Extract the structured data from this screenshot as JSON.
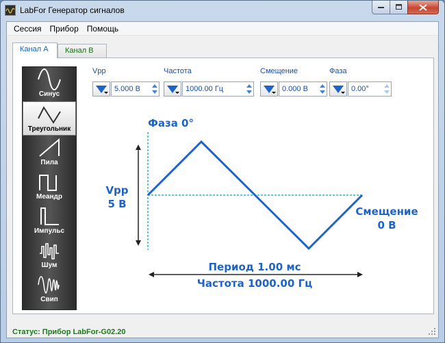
{
  "window": {
    "title": "LabFor Генератор сигналов"
  },
  "menu": [
    "Сессия",
    "Прибор",
    "Помощь"
  ],
  "tabs": [
    {
      "label": "Канал A",
      "active": true
    },
    {
      "label": "Канал B",
      "active": false
    }
  ],
  "waveforms": [
    {
      "label": "Синус",
      "icon": "sine-wave-icon",
      "active": false
    },
    {
      "label": "Треугольник",
      "icon": "triangle-wave-icon",
      "active": true
    },
    {
      "label": "Пила",
      "icon": "sawtooth-wave-icon",
      "active": false
    },
    {
      "label": "Меандр",
      "icon": "square-wave-icon",
      "active": false
    },
    {
      "label": "Импульс",
      "icon": "pulse-wave-icon",
      "active": false
    },
    {
      "label": "Шум",
      "icon": "noise-wave-icon",
      "active": false
    },
    {
      "label": "Свип",
      "icon": "sweep-wave-icon",
      "active": false
    }
  ],
  "params": {
    "vpp": {
      "label": "Vpp",
      "value": "5.000 В"
    },
    "freq": {
      "label": "Частота",
      "value": "1000.00 Гц"
    },
    "offset": {
      "label": "Смещение",
      "value": "0.000 В"
    },
    "phase": {
      "label": "Фаза",
      "value": "0.00°"
    }
  },
  "diagram": {
    "phase_label": "Фаза 0°",
    "vpp_label": "Vpp",
    "vpp_value": "5 В",
    "offset_label": "Смещение",
    "offset_value": "0 В",
    "period_label": "Период 1.00 мс",
    "freq_label": "Частота 1000.00 Гц",
    "wave_color": "#1e63c7",
    "guide_color": "#2bb3d6"
  },
  "status": {
    "text": "Статус:   Прибор LabFor-G02.20"
  }
}
